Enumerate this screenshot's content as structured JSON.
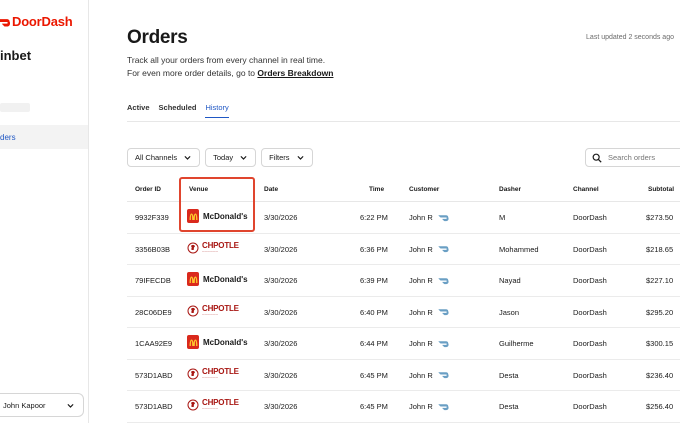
{
  "brand": {
    "name": "DoorDash",
    "color": "#eb1700"
  },
  "sidebar": {
    "store_name": "inbet",
    "active_item_label": "ders",
    "user_name": "John Kapoor"
  },
  "header": {
    "title": "Orders",
    "last_updated": "Last updated 2 seconds ago",
    "subtitle_line1": "Track all your orders from every channel in real time.",
    "subtitle_line2_prefix": "For even more order details, go to ",
    "subtitle_line2_link": "Orders Breakdown"
  },
  "tabs": [
    {
      "label": "Active",
      "active": false
    },
    {
      "label": "Scheduled",
      "active": false
    },
    {
      "label": "History",
      "active": true
    }
  ],
  "filters": {
    "channels": "All Channels",
    "date": "Today",
    "more": "Filters",
    "search_placeholder": "Search orders"
  },
  "table": {
    "columns": [
      "Order ID",
      "Venue",
      "Date",
      "Time",
      "Customer",
      "Dasher",
      "Channel",
      "Subtotal"
    ],
    "rows": [
      {
        "id": "9932F339",
        "venue": "mcdonalds",
        "venue_label": "McDonald's",
        "date": "3/30/2026",
        "time": "6:22 PM",
        "customer": "John R",
        "dasher": "M",
        "channel": "DoorDash",
        "subtotal": "$273.50"
      },
      {
        "id": "3356B03B",
        "venue": "chipotle",
        "venue_label": "CHPOTLE",
        "date": "3/30/2026",
        "time": "6:36 PM",
        "customer": "John R",
        "dasher": "Mohammed",
        "channel": "DoorDash",
        "subtotal": "$218.65"
      },
      {
        "id": "79IFECDB",
        "venue": "mcdonalds",
        "venue_label": "McDonald's",
        "date": "3/30/2026",
        "time": "6:39 PM",
        "customer": "John R",
        "dasher": "Nayad",
        "channel": "DoorDash",
        "subtotal": "$227.10"
      },
      {
        "id": "28C06DE9",
        "venue": "chipotle",
        "venue_label": "CHPOTLE",
        "date": "3/30/2026",
        "time": "6:40 PM",
        "customer": "John R",
        "dasher": "Jason",
        "channel": "DoorDash",
        "subtotal": "$295.20"
      },
      {
        "id": "1CAA92E9",
        "venue": "mcdonalds",
        "venue_label": "McDonald's",
        "date": "3/30/2026",
        "time": "6:44 PM",
        "customer": "John R",
        "dasher": "Guilherme",
        "channel": "DoorDash",
        "subtotal": "$300.15"
      },
      {
        "id": "573D1ABD",
        "venue": "chipotle",
        "venue_label": "CHPOTLE",
        "date": "3/30/2026",
        "time": "6:45 PM",
        "customer": "John R",
        "dasher": "Desta",
        "channel": "DoorDash",
        "subtotal": "$236.40"
      },
      {
        "id": "573D1ABD",
        "venue": "chipotle",
        "venue_label": "CHPOTLE",
        "date": "3/30/2026",
        "time": "6:45 PM",
        "customer": "John R",
        "dasher": "Desta",
        "channel": "DoorDash",
        "subtotal": "$256.40"
      }
    ]
  },
  "colors": {
    "accent": "#1f57c4",
    "highlight": "#e0452e",
    "mcdonalds": "#da291c",
    "chipotle": "#a81612"
  }
}
